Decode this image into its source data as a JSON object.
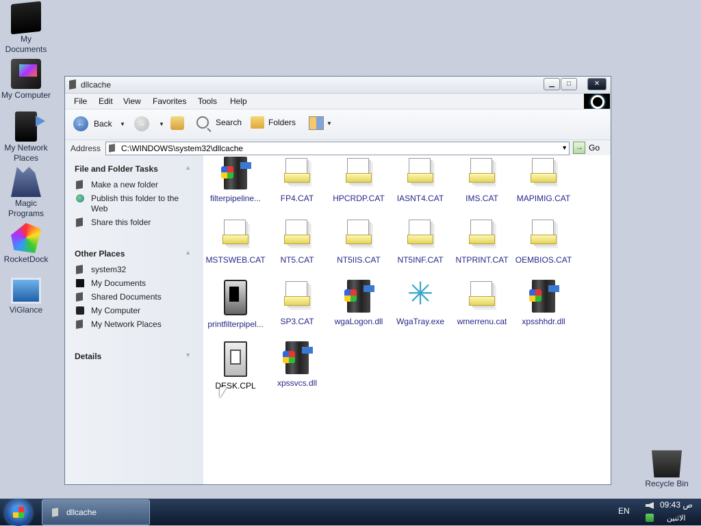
{
  "desktop": {
    "icons": [
      {
        "label1": "My",
        "label2": "Documents"
      },
      {
        "label1": "My Computer",
        "label2": ""
      },
      {
        "label1": "My Network",
        "label2": "Places"
      },
      {
        "label1": "Magic",
        "label2": "Programs"
      },
      {
        "label1": "RocketDock",
        "label2": ""
      },
      {
        "label1": "ViGlance",
        "label2": ""
      },
      {
        "label1": "Recycle Bin",
        "label2": ""
      }
    ]
  },
  "window": {
    "title": "dllcache",
    "buttons": {
      "minimize": "▁",
      "maximize": "□",
      "close": "✕"
    }
  },
  "menu": {
    "items": [
      "File",
      "Edit",
      "View",
      "Favorites",
      "Tools",
      "Help"
    ]
  },
  "toolbar": {
    "back_label": "Back",
    "search_label": "Search",
    "folders_label": "Folders"
  },
  "address": {
    "label": "Address",
    "value": "C:\\WINDOWS\\system32\\dllcache",
    "go_label": "Go"
  },
  "taskpane": {
    "file_tasks": {
      "title": "File and Folder Tasks",
      "items": [
        "Make a new folder",
        "Publish this folder to the Web",
        "Share this folder"
      ]
    },
    "other_places": {
      "title": "Other Places",
      "items": [
        "system32",
        "My Documents",
        "Shared Documents",
        "My Computer",
        "My Network Places"
      ]
    },
    "details": {
      "title": "Details"
    }
  },
  "files": [
    {
      "name": "filterpipeline...",
      "icon": "dll-icon"
    },
    {
      "name": "FP4.CAT",
      "icon": "catalog-icon"
    },
    {
      "name": "HPCRDP.CAT",
      "icon": "catalog-icon"
    },
    {
      "name": "IASNT4.CAT",
      "icon": "catalog-icon"
    },
    {
      "name": "IMS.CAT",
      "icon": "catalog-icon"
    },
    {
      "name": "MAPIMIG.CAT",
      "icon": "catalog-icon"
    },
    {
      "name": "MSTSWEB.CAT",
      "icon": "catalog-icon"
    },
    {
      "name": "NT5.CAT",
      "icon": "catalog-icon"
    },
    {
      "name": "NT5IIS.CAT",
      "icon": "catalog-icon"
    },
    {
      "name": "NT5INF.CAT",
      "icon": "catalog-icon"
    },
    {
      "name": "NTPRINT.CAT",
      "icon": "catalog-icon"
    },
    {
      "name": "OEMBIOS.CAT",
      "icon": "catalog-icon"
    },
    {
      "name": "printfilterpipel...",
      "icon": "printer-dll-icon"
    },
    {
      "name": "SP3.CAT",
      "icon": "catalog-icon"
    },
    {
      "name": "wgaLogon.dll",
      "icon": "dll-icon"
    },
    {
      "name": "WgaTray.exe",
      "icon": "star-icon"
    },
    {
      "name": "wmerrenu.cat",
      "icon": "catalog-icon"
    },
    {
      "name": "xpsshhdr.dll",
      "icon": "dll-icon"
    },
    {
      "name": "DESK.CPL",
      "icon": "control-panel-icon"
    },
    {
      "name": "xpssvcs.dll",
      "icon": "dll-icon"
    }
  ],
  "taskbar": {
    "task_label": "dllcache",
    "language": "EN",
    "time": "09:43 ص",
    "day": "الاثنين"
  }
}
